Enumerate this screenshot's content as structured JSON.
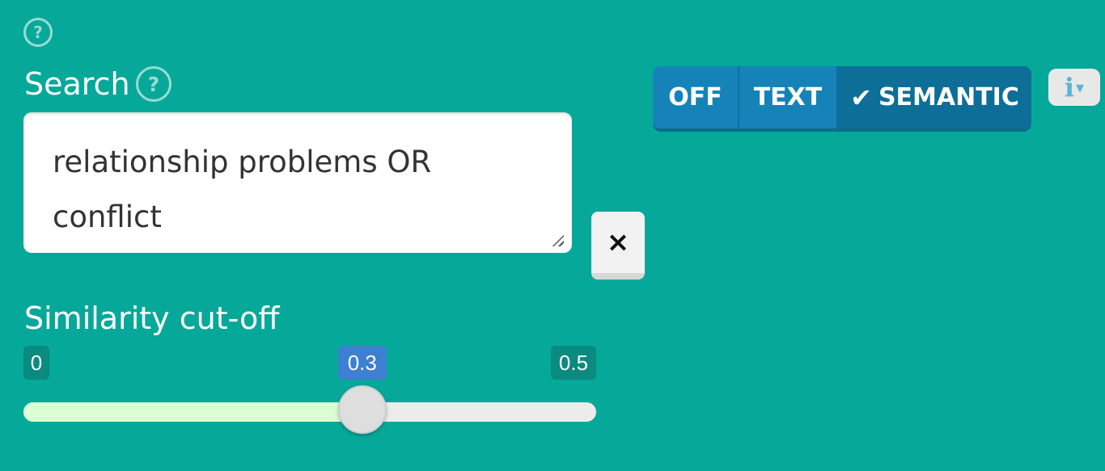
{
  "top_help": {
    "icon": "help-icon",
    "glyph": "?"
  },
  "search": {
    "label": "Search",
    "help_glyph": "?",
    "value_line1": "relationship problems OR",
    "value_line2": "conflict",
    "clear_glyph": "×"
  },
  "mode_toggle": {
    "options": [
      {
        "label": "OFF",
        "selected": false
      },
      {
        "label": "TEXT",
        "selected": false
      },
      {
        "label": "SEMANTIC",
        "selected": true
      }
    ],
    "check_glyph": "✔"
  },
  "info_button": {
    "glyph": "i",
    "caret": "▾"
  },
  "similarity": {
    "label": "Similarity cut-off",
    "min_label": "0",
    "current_label": "0.3",
    "max_label": "0.5",
    "min": 0,
    "max": 0.5,
    "value": 0.3
  },
  "colors": {
    "background": "#06a899",
    "selected_mode": "#0d6e97",
    "current_tick": "#3d7fd1",
    "slider_fill": "#d9ffd3"
  }
}
